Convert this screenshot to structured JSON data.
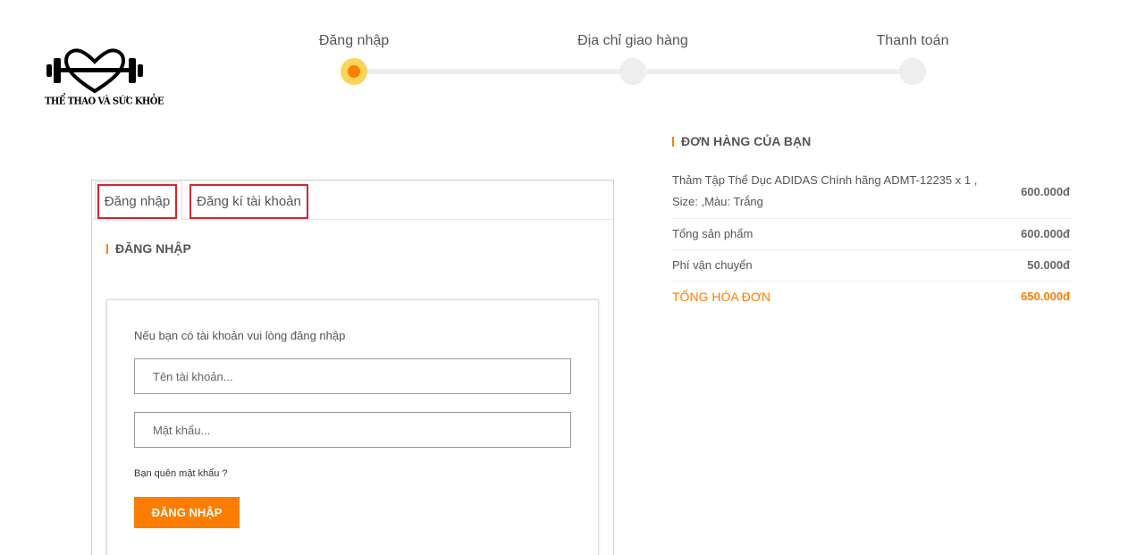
{
  "logo": {
    "text": "THỂ THAO VÀ SỨC KHỎE"
  },
  "stepper": {
    "steps": [
      {
        "label": "Đăng nhập",
        "active": true
      },
      {
        "label": "Địa chỉ giao hàng",
        "active": false
      },
      {
        "label": "Thanh toán",
        "active": false
      }
    ]
  },
  "tabs": {
    "login": "Đăng nhập",
    "register": "Đăng kí tài khoản"
  },
  "login_section": {
    "title": "ĐĂNG NHẬP",
    "hint": "Nếu bạn có tài khoản vui lòng đăng nhập",
    "username_placeholder": "Tên tài khoản...",
    "password_placeholder": "Mật khẩu...",
    "forgot": "Bạn quên mật khẩu ?",
    "submit": "ĐĂNG NHẬP"
  },
  "order": {
    "title": "ĐƠN HÀNG CỦA BẠN",
    "product": "Thảm Tập Thể Dục ADIDAS Chính hãng ADMT-12235 x 1 , Size: ,Màu: Trắng",
    "product_price": "600.000đ",
    "subtotal_label": "Tổng sản phẩm",
    "subtotal_value": "600.000đ",
    "shipping_label": "Phí vận chuyển",
    "shipping_value": "50.000đ",
    "total_label": "TỔNG HÓA ĐƠN",
    "total_value": "650.000đ"
  },
  "colors": {
    "accent": "#fc7d00",
    "step_active_ring": "#fbd45a",
    "tab_highlight": "#d9242f"
  },
  "icons": {
    "logo": "barbell-heart-icon"
  }
}
